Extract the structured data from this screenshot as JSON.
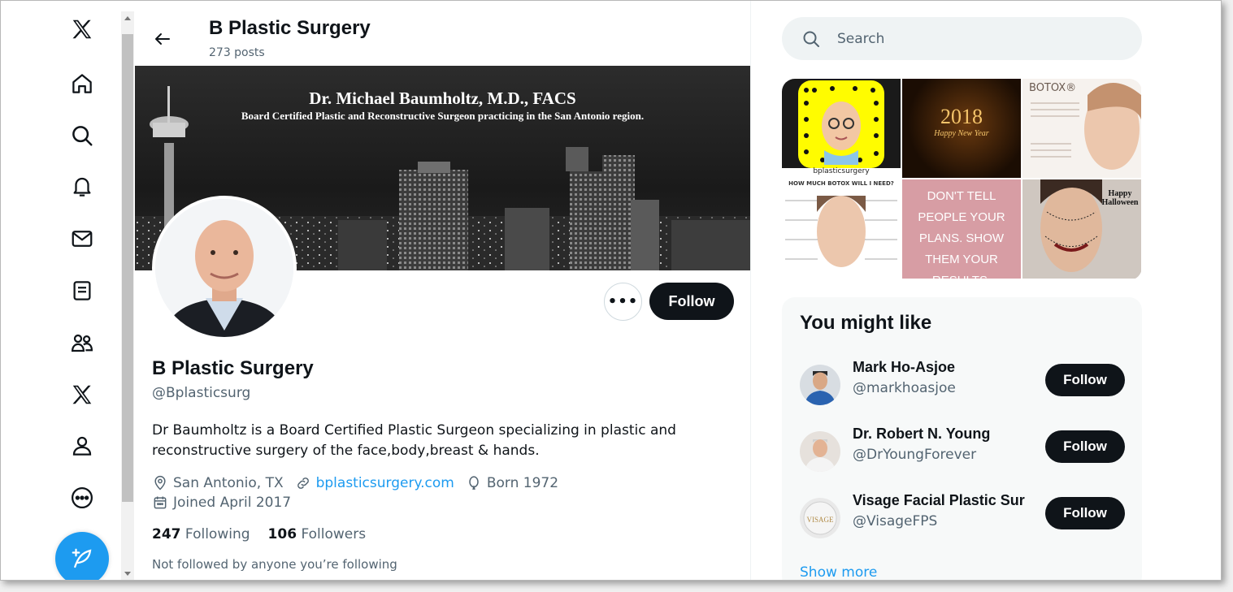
{
  "header": {
    "title": "B Plastic Surgery",
    "post_count": "273 posts"
  },
  "banner": {
    "title": "Dr. Michael Baumholtz, M.D., FACS",
    "subtitle": "Board Certified Plastic and Reconstructive Surgeon practicing in the San Antonio region."
  },
  "nav": {
    "items": [
      "x-logo-icon",
      "home-icon",
      "explore-icon",
      "notifications-icon",
      "messages-icon",
      "lists-icon",
      "communities-icon",
      "premium-icon",
      "profile-icon",
      "more-icon"
    ],
    "compose": "compose-icon"
  },
  "profile": {
    "more_label": "•••",
    "follow_label": "Follow",
    "name": "B Plastic Surgery",
    "handle": "@Bplasticsurg",
    "bio": "Dr Baumholtz is a Board Certified Plastic Surgeon specializing in plastic and reconstructive surgery of the face,body,breast & hands.",
    "location": "San Antonio, TX",
    "website": "bplasticsurgery.com",
    "born": "Born 1972",
    "joined": "Joined April 2017",
    "following_count": "247",
    "following_label": "Following",
    "followers_count": "106",
    "followers_label": "Followers",
    "not_followed": "Not followed by anyone you’re following"
  },
  "search": {
    "placeholder": "Search"
  },
  "media": {
    "tile2_text": "2018",
    "tile2_sub": "Happy New Year",
    "tile3_text": "BOTOX®",
    "tile4_text": "HOW MUCH BOTOX WILL I NEED?",
    "tile5_text": "DON'T TELL PEOPLE YOUR PLANS. SHOW THEM YOUR RESULTS.",
    "tile6_text": "Happy Halloween",
    "tile1_caption": "bplasticsurgery"
  },
  "who_to_follow": {
    "title": "You might like",
    "follow_label": "Follow",
    "suggestions": [
      {
        "name": "Mark Ho-Asjoe",
        "handle": "@markhoasjoe"
      },
      {
        "name": "Dr. Robert N. Young",
        "handle": "@DrYoungForever"
      },
      {
        "name": "Visage Facial Plastic Sur",
        "handle": "@VisageFPS"
      }
    ],
    "show_more": "Show more"
  },
  "colors": {
    "accent": "#1d9bf0",
    "button_dark": "#0f1419",
    "muted": "#536471"
  }
}
